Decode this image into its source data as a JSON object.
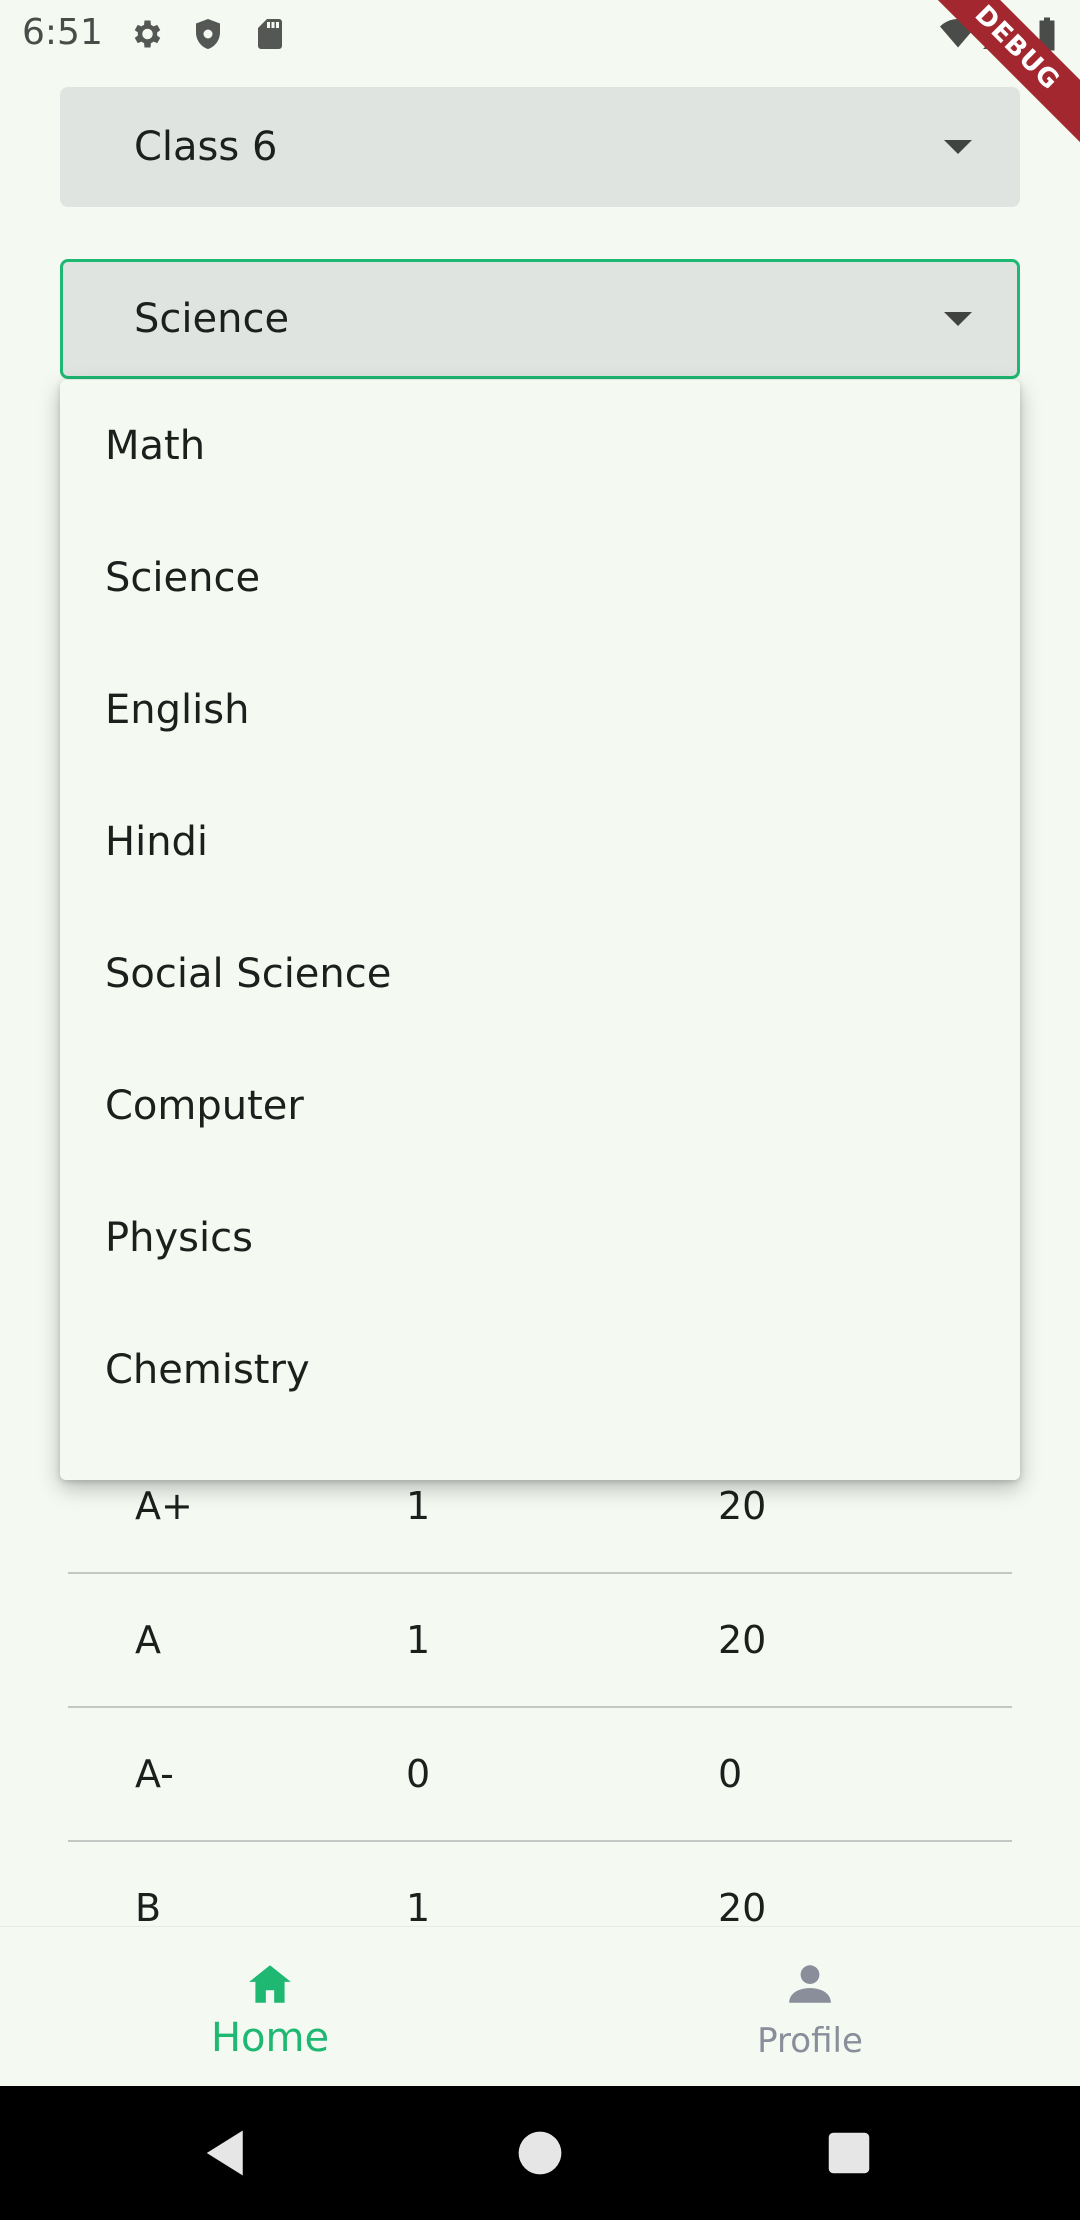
{
  "status_bar": {
    "time": "6:51",
    "debug_label": "DEBUG",
    "icons": [
      "settings-icon",
      "shield-icon",
      "sd-card-icon",
      "wifi-icon",
      "cell-signal-icon",
      "battery-icon"
    ]
  },
  "class_select": {
    "value": "Class 6"
  },
  "subject_select": {
    "value": "Science",
    "focus_color": "#1eb872"
  },
  "subject_menu": {
    "items": [
      "Math",
      "Science",
      "English",
      "Hindi",
      "Social Science",
      "Computer",
      "Physics",
      "Chemistry"
    ]
  },
  "grade_table": {
    "rows": [
      {
        "grade": "A+",
        "count": "1",
        "percent": "20"
      },
      {
        "grade": "A",
        "count": "1",
        "percent": "20"
      },
      {
        "grade": "A-",
        "count": "0",
        "percent": "0"
      },
      {
        "grade": "B",
        "count": "1",
        "percent": "20"
      }
    ]
  },
  "bottom_nav": {
    "home_label": "Home",
    "profile_label": "Profile",
    "active": "home",
    "active_color": "#1eb872",
    "inactive_color": "#8a8d9a"
  },
  "system_nav": {
    "icons": [
      "back-icon",
      "home-circle-icon",
      "recents-icon"
    ]
  }
}
